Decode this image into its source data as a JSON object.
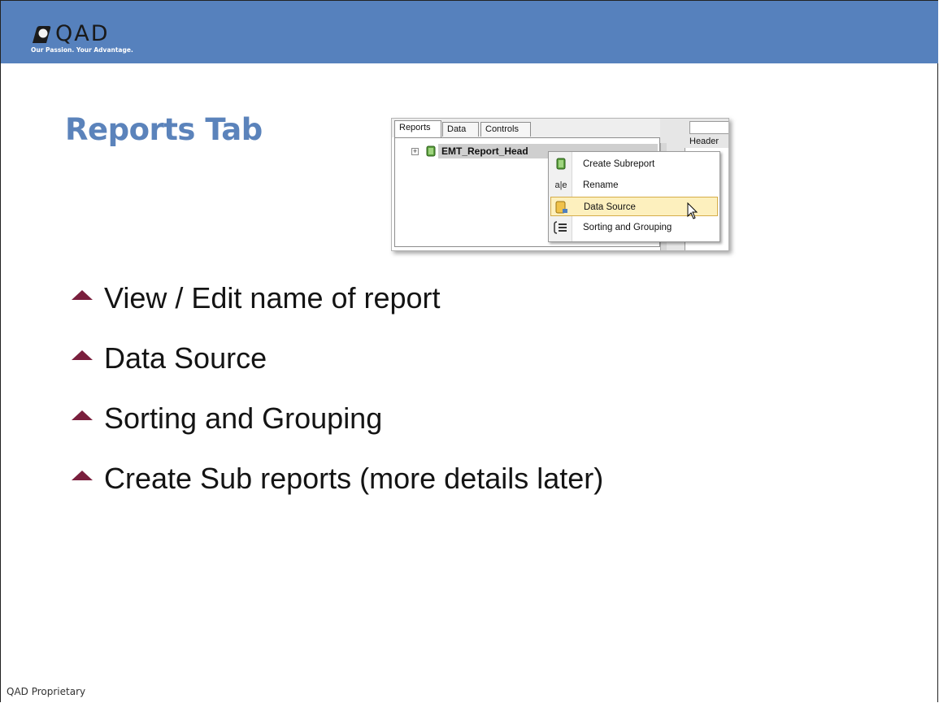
{
  "brand": {
    "logo_text": "QAD",
    "tagline": "Our Passion. Your Advantage.",
    "header_color": "#5681bd"
  },
  "slide": {
    "title": "Reports Tab",
    "title_color": "#5b83bb",
    "bullet_color": "#7a1f3d",
    "bullets": [
      "View / Edit name of report",
      "Data Source",
      "Sorting and Grouping",
      "Create Sub reports (more details later)"
    ],
    "footer": "QAD Proprietary"
  },
  "screenshot": {
    "tabs": [
      {
        "label": "Reports",
        "active": true
      },
      {
        "label": "Data",
        "active": false
      },
      {
        "label": "Controls",
        "active": false
      }
    ],
    "tree_node": {
      "label": "EMT_Report_Head",
      "icon": "database-icon",
      "expander": "+"
    },
    "right_pane_label": "Header",
    "context_menu": {
      "items": [
        {
          "label": "Create Subreport",
          "icon": "subreport-icon",
          "highlighted": false
        },
        {
          "label": "Rename",
          "icon": "rename-icon",
          "highlighted": false
        },
        {
          "label": "Data Source",
          "icon": "data-source-icon",
          "highlighted": true
        },
        {
          "label": "Sorting and Grouping",
          "icon": "sorting-grouping-icon",
          "highlighted": false
        }
      ]
    }
  }
}
